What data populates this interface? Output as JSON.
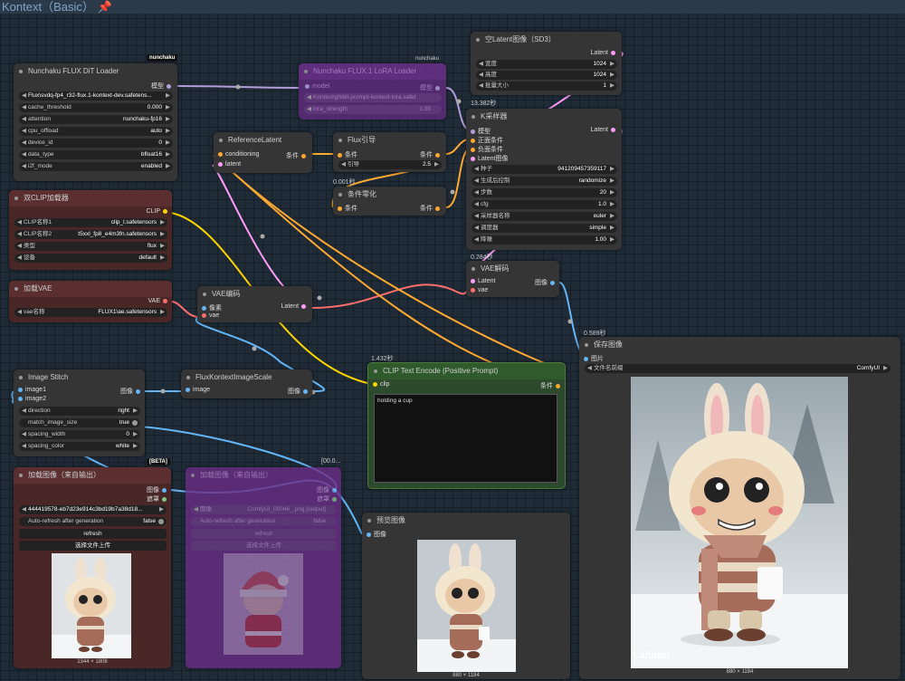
{
  "window": {
    "title": "Kontext（Basic）",
    "pin_icon": "pin-icon"
  },
  "colors": {
    "model": "#b39ddb",
    "clip": "#ffd500",
    "vae": "#ff6e6e",
    "latent": "#ff9cf9",
    "conditioning": "#ffa931",
    "image": "#64b5f6"
  },
  "nodes": {
    "dit_loader": {
      "badge": "nunchaku",
      "title": "Nunchaku FLUX DiT Loader",
      "out": "模型",
      "widgets": [
        {
          "l": "",
          "v": "Flux\\svdq-fp4_r32-flux.1-kontext-dev.safetens..."
        },
        {
          "l": "cache_threshold",
          "v": "0.000"
        },
        {
          "l": "attention",
          "v": "nunchaku-fp16"
        },
        {
          "l": "cpu_offload",
          "v": "auto"
        },
        {
          "l": "device_id",
          "v": "0"
        },
        {
          "l": "data_type",
          "v": "bfloat16"
        },
        {
          "l": "i2f_mode",
          "v": "enabled"
        }
      ]
    },
    "lora": {
      "badge": "nunchaku",
      "title": "Nunchaku FLUX.1 LoRA Loader",
      "in": "model",
      "out": "模型",
      "w1": "Kontext\\ghibli-prompt-kontext-lora.safet",
      "w2l": "lora_strength",
      "w2v": "1.00"
    },
    "empty_latent": {
      "title": "空Latent图像（SD3）",
      "out": "Latent",
      "widgets": [
        {
          "l": "宽度",
          "v": "1024"
        },
        {
          "l": "高度",
          "v": "1024"
        },
        {
          "l": "批量大小",
          "v": "1"
        }
      ]
    },
    "ksampler": {
      "time": "13.382秒",
      "title": "K采样器",
      "out": "Latent",
      "ins": [
        "模型",
        "正面条件",
        "负面条件",
        "Latent图像"
      ],
      "widgets": [
        {
          "l": "种子",
          "v": "941209457359117"
        },
        {
          "l": "生成后控制",
          "v": "randomize"
        },
        {
          "l": "步数",
          "v": "20"
        },
        {
          "l": "cfg",
          "v": "1.0"
        },
        {
          "l": "采样器名称",
          "v": "euler"
        },
        {
          "l": "调度器",
          "v": "simple"
        },
        {
          "l": "降噪",
          "v": "1.00"
        }
      ]
    },
    "ref_latent": {
      "title": "ReferenceLatent",
      "in1": "conditioning",
      "in2": "latent",
      "out": "条件"
    },
    "flux_guid": {
      "title": "Flux引导",
      "in": "条件",
      "out": "条件",
      "wl": "引导",
      "wv": "2.5"
    },
    "cond_zero": {
      "time": "0.001秒",
      "title": "条件零化",
      "in": "条件",
      "out": "条件"
    },
    "dual_clip": {
      "title": "双CLIP加载器",
      "out": "CLIP",
      "widgets": [
        {
          "l": "CLIP名称1",
          "v": "clip_l.safetensors"
        },
        {
          "l": "CLIP名称2",
          "v": "t5xxl_fp8_e4m3fn.safetensors"
        },
        {
          "l": "类型",
          "v": "flux"
        },
        {
          "l": "设备",
          "v": "default"
        }
      ]
    },
    "vae_loader": {
      "title": "加载VAE",
      "out": "VAE",
      "wl": "vae名称",
      "wv": "FLUX1\\ae.safetensors"
    },
    "vae_encode": {
      "title": "VAE编码",
      "in1": "像素",
      "in2": "vae",
      "out": "Latent"
    },
    "vae_decode": {
      "time": "0.284秒",
      "title": "VAE解码",
      "in1": "Latent",
      "in2": "vae",
      "out": "图像"
    },
    "save": {
      "time": "0.589秒",
      "title": "保存图像",
      "in": "图片",
      "wl": "文件名前缀",
      "wv": "ComfyUI",
      "dims": "880 × 1184",
      "watermark": "Labubu"
    },
    "clip_text": {
      "time": "1.432秒",
      "title": "CLIP Text Encode (Positive Prompt)",
      "in": "clip",
      "out": "条件",
      "text": "holding a cup"
    },
    "stitch": {
      "title": "Image Stitch",
      "in1": "image1",
      "in2": "image2",
      "out": "图像",
      "widgets": [
        {
          "l": "direction",
          "v": "right"
        },
        {
          "l": "match_image_size",
          "v": "true"
        },
        {
          "l": "spacing_width",
          "v": "0"
        },
        {
          "l": "spacing_color",
          "v": "white"
        }
      ]
    },
    "scale": {
      "title": "FluxKontextImageScale",
      "in": "image",
      "out": "图像"
    },
    "load_img1": {
      "badge": "[BETA]",
      "title": "加载图像（来自输出）",
      "out1": "图像",
      "out2": "遮罩",
      "wv": "444419578-eb7d23e914c3bd19b7a38d18...",
      "autol": "Auto-refresh after generation",
      "autov": "false",
      "refresh": "refresh",
      "upload": "选择文件上传",
      "dims": "1344 × 1808"
    },
    "load_img2": {
      "time": "[00.0...",
      "title": "加载图像（来自输出）",
      "out1": "图像",
      "out2": "遮罩",
      "wl": "图像",
      "wv": "ComfyUI_00046_.png [output]",
      "autol": "Auto-refresh after generation",
      "autov": "false",
      "refresh": "refresh",
      "upload": "选择文件上传"
    },
    "preview": {
      "title": "预览图像",
      "in": "图像",
      "dims": "880 × 1184"
    }
  }
}
